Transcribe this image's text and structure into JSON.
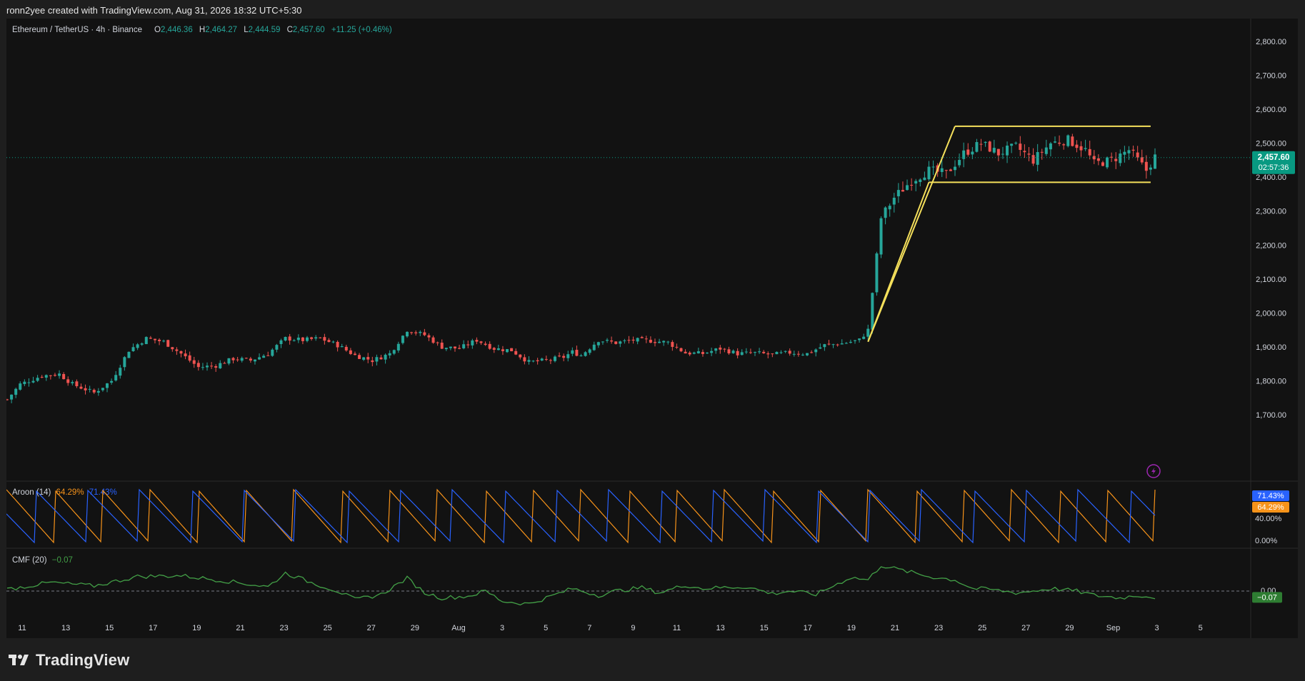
{
  "header": {
    "attribution": "ronn2yee created with TradingView.com, Aug 31, 2026 18:32 UTC+5:30"
  },
  "legend": {
    "symbol": "Ethereum / TetherUS · 4h · Binance",
    "o_label": "O",
    "o_value": "2,446.36",
    "h_label": "H",
    "h_value": "2,464.27",
    "l_label": "L",
    "l_value": "2,444.59",
    "c_label": "C",
    "c_value": "2,457.60",
    "change": "+11.25 (+0.46%)"
  },
  "price_badge": {
    "price": "2,457.60",
    "countdown": "02:57:36"
  },
  "aroon": {
    "title": "Aroon (14)",
    "up_value": "64.29%",
    "down_value": "71.43%",
    "axis_labels": [
      "40.00%",
      "0.00%"
    ]
  },
  "cmf": {
    "title": "CMF (20)",
    "value": "−0.07",
    "badge": "−0.07",
    "zero_label": "0.00"
  },
  "footer": {
    "brand": "TradingView"
  },
  "colors": {
    "up": "#26a69a",
    "down": "#ef5350",
    "pattern": "#f5e05b",
    "aroon_up": "#f7931a",
    "aroon_down": "#2962ff",
    "cmf": "#43a047",
    "bg": "#121212",
    "badge": "#089981"
  },
  "chart_data": [
    {
      "type": "candlestick",
      "timeframe": "4h",
      "ylim": [
        1680,
        2840
      ],
      "y_ticks": [
        1700,
        1800,
        1900,
        2000,
        2100,
        2200,
        2300,
        2400,
        2500,
        2600,
        2700,
        2800
      ],
      "y_tick_labels": [
        "1,700.00",
        "1,800.00",
        "1,900.00",
        "2,000.00",
        "2,100.00",
        "2,200.00",
        "2,300.00",
        "2,400.00",
        "2,500.00",
        "2,600.00",
        "2,700.00",
        "2,800.00"
      ],
      "x_labels": [
        "11",
        "13",
        "15",
        "17",
        "19",
        "21",
        "23",
        "25",
        "27",
        "29",
        "Aug",
        "3",
        "5",
        "7",
        "9",
        "11",
        "13",
        "15",
        "17",
        "19",
        "21",
        "23",
        "25",
        "27",
        "29",
        "Sep",
        "3",
        "5"
      ],
      "close_path": [
        [
          0,
          1745
        ],
        [
          3,
          1790
        ],
        [
          8,
          1815
        ],
        [
          12,
          1820
        ],
        [
          15,
          1790
        ],
        [
          20,
          1765
        ],
        [
          24,
          1800
        ],
        [
          28,
          1890
        ],
        [
          32,
          1925
        ],
        [
          36,
          1915
        ],
        [
          40,
          1880
        ],
        [
          44,
          1840
        ],
        [
          48,
          1845
        ],
        [
          52,
          1865
        ],
        [
          56,
          1860
        ],
        [
          60,
          1880
        ],
        [
          64,
          1925
        ],
        [
          68,
          1920
        ],
        [
          72,
          1925
        ],
        [
          76,
          1905
        ],
        [
          80,
          1875
        ],
        [
          84,
          1860
        ],
        [
          88,
          1880
        ],
        [
          92,
          1950
        ],
        [
          96,
          1935
        ],
        [
          100,
          1900
        ],
        [
          104,
          1895
        ],
        [
          108,
          1920
        ],
        [
          112,
          1895
        ],
        [
          116,
          1890
        ],
        [
          120,
          1855
        ],
        [
          124,
          1860
        ],
        [
          128,
          1870
        ],
        [
          130,
          1885
        ],
        [
          132,
          1875
        ],
        [
          136,
          1920
        ],
        [
          140,
          1912
        ],
        [
          144,
          1920
        ],
        [
          148,
          1918
        ],
        [
          152,
          1913
        ],
        [
          156,
          1882
        ],
        [
          160,
          1880
        ],
        [
          164,
          1895
        ],
        [
          168,
          1880
        ],
        [
          172,
          1882
        ],
        [
          176,
          1877
        ],
        [
          180,
          1883
        ],
        [
          184,
          1880
        ],
        [
          188,
          1905
        ],
        [
          192,
          1910
        ],
        [
          196,
          1920
        ],
        [
          198,
          1950
        ],
        [
          201,
          2280
        ],
        [
          204,
          2340
        ],
        [
          208,
          2390
        ],
        [
          212,
          2420
        ],
        [
          216,
          2410
        ],
        [
          220,
          2470
        ],
        [
          224,
          2500
        ],
        [
          228,
          2470
        ],
        [
          232,
          2490
        ],
        [
          236,
          2450
        ],
        [
          240,
          2500
        ],
        [
          244,
          2510
        ],
        [
          248,
          2480
        ],
        [
          250,
          2440
        ],
        [
          254,
          2450
        ],
        [
          258,
          2480
        ],
        [
          262,
          2420
        ],
        [
          264,
          2460
        ]
      ],
      "range_start": "Jul 10",
      "range_end": "Aug 31"
    },
    {
      "type": "line",
      "name": "Aroon (14)",
      "ylim": [
        0,
        100
      ],
      "series": [
        {
          "name": "Aroon Up",
          "current": 64.29
        },
        {
          "name": "Aroon Down",
          "current": 71.43
        }
      ]
    },
    {
      "type": "line",
      "name": "CMF (20)",
      "ylim": [
        -0.3,
        0.35
      ],
      "current": -0.07,
      "path": [
        [
          0,
          0.02
        ],
        [
          10,
          0.1
        ],
        [
          20,
          0.06
        ],
        [
          30,
          0.17
        ],
        [
          40,
          0.18
        ],
        [
          50,
          0.12
        ],
        [
          60,
          0.05
        ],
        [
          64,
          0.21
        ],
        [
          70,
          0.1
        ],
        [
          76,
          0.0
        ],
        [
          80,
          -0.1
        ],
        [
          86,
          -0.04
        ],
        [
          92,
          0.15
        ],
        [
          96,
          -0.02
        ],
        [
          100,
          -0.08
        ],
        [
          106,
          -0.06
        ],
        [
          110,
          0.0
        ],
        [
          114,
          -0.12
        ],
        [
          120,
          -0.15
        ],
        [
          124,
          -0.08
        ],
        [
          130,
          0.03
        ],
        [
          136,
          -0.05
        ],
        [
          140,
          0.0
        ],
        [
          146,
          0.04
        ],
        [
          150,
          -0.02
        ],
        [
          156,
          0.07
        ],
        [
          160,
          0.03
        ],
        [
          164,
          0.04
        ],
        [
          170,
          0.05
        ],
        [
          176,
          -0.03
        ],
        [
          180,
          0.0
        ],
        [
          186,
          -0.04
        ],
        [
          190,
          0.06
        ],
        [
          194,
          0.16
        ],
        [
          198,
          0.13
        ],
        [
          201,
          0.3
        ],
        [
          206,
          0.24
        ],
        [
          212,
          0.17
        ],
        [
          218,
          0.13
        ],
        [
          222,
          0.03
        ],
        [
          226,
          0.02
        ],
        [
          232,
          -0.02
        ],
        [
          236,
          0.0
        ],
        [
          240,
          0.03
        ],
        [
          246,
          0.0
        ],
        [
          250,
          -0.05
        ],
        [
          256,
          -0.08
        ],
        [
          260,
          -0.05
        ],
        [
          264,
          -0.07
        ]
      ]
    }
  ]
}
